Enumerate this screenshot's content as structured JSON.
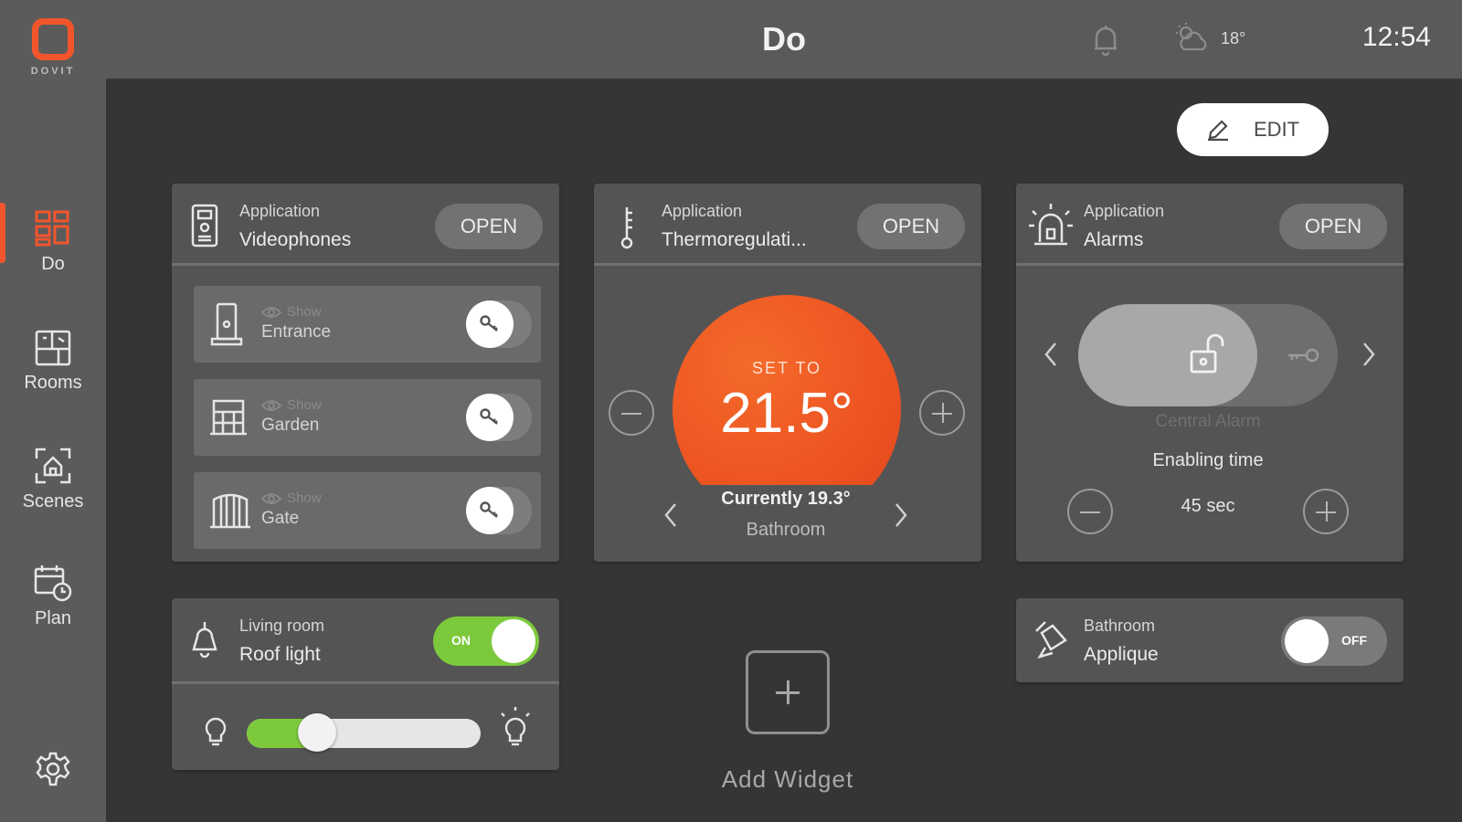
{
  "app": {
    "logo_text": "DOVIT",
    "accent": "#f2552c"
  },
  "sidebar": {
    "items": [
      {
        "label": "Do",
        "icon": "do-grid-icon",
        "active": true
      },
      {
        "label": "Rooms",
        "icon": "rooms-icon",
        "active": false
      },
      {
        "label": "Scenes",
        "icon": "scenes-icon",
        "active": false
      },
      {
        "label": "Plan",
        "icon": "plan-calendar-icon",
        "active": false
      }
    ],
    "settings_icon": "gear-icon"
  },
  "topbar": {
    "title": "Do",
    "weather_temp": "18°",
    "time": "12:54"
  },
  "edit_label": "EDIT",
  "videophones": {
    "subtitle": "Application",
    "title": "Videophones",
    "open_label": "OPEN",
    "items": [
      {
        "show": "Show",
        "name": "Entrance",
        "icon": "intercom-icon"
      },
      {
        "show": "Show",
        "name": "Garden",
        "icon": "garden-gate-icon"
      },
      {
        "show": "Show",
        "name": "Gate",
        "icon": "gate-icon"
      }
    ]
  },
  "thermo": {
    "subtitle": "Application",
    "title": "Thermoregulati...",
    "open_label": "OPEN",
    "set_to": "SET TO",
    "set_value": "21.5°",
    "current": "Currently 19.3°",
    "room": "Bathroom"
  },
  "alarms": {
    "subtitle": "Application",
    "title": "Alarms",
    "open_label": "OPEN",
    "name": "Central Alarm",
    "enabling_label": "Enabling time",
    "enabling_value": "45 sec"
  },
  "roof_light": {
    "room": "Living room",
    "name": "Roof light",
    "state_label": "ON",
    "on": true,
    "brightness": 0.3,
    "on_color": "#7dc93c"
  },
  "applique": {
    "room": "Bathroom",
    "name": "Applique",
    "state_label": "OFF",
    "on": false
  },
  "add_widget": {
    "label": "Add Widget"
  }
}
